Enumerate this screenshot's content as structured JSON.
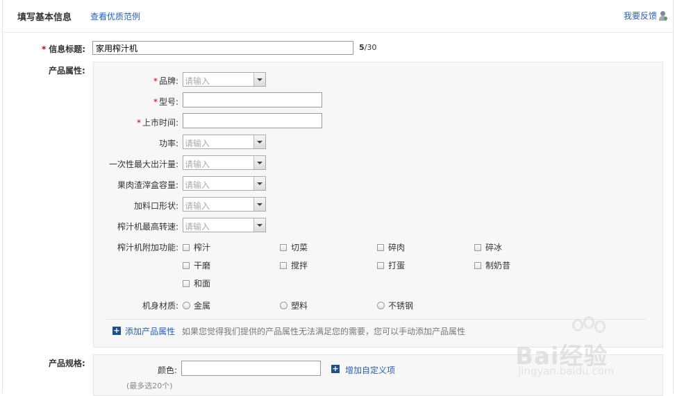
{
  "header": {
    "title": "填写基本信息",
    "example_link": "查看优质范例",
    "feedback": "我要反馈"
  },
  "info_title": {
    "required_mark": "*",
    "label": "信息标题:",
    "value": "家用榨汁机",
    "counter_current": "5",
    "counter_total": "/30"
  },
  "attributes": {
    "label": "产品属性:",
    "fields": [
      {
        "required": "*",
        "label": "品牌:",
        "type": "select",
        "placeholder": "请输入"
      },
      {
        "required": "*",
        "label": "型号:",
        "type": "text",
        "value": ""
      },
      {
        "required": "*",
        "label": "上市时间:",
        "type": "text",
        "value": ""
      },
      {
        "required": "",
        "label": "功率:",
        "type": "select",
        "placeholder": "请输入"
      },
      {
        "required": "",
        "label": "一次性最大出汁量:",
        "type": "select",
        "placeholder": "请输入"
      },
      {
        "required": "",
        "label": "果肉渣滓盒容量:",
        "type": "select",
        "placeholder": "请输入"
      },
      {
        "required": "",
        "label": "加料口形状:",
        "type": "select",
        "placeholder": "请输入"
      },
      {
        "required": "",
        "label": "榨汁机最高转速:",
        "type": "select",
        "placeholder": "请输入"
      }
    ],
    "functions": {
      "label": "榨汁机附加功能:",
      "options": [
        "榨汁",
        "切菜",
        "碎肉",
        "碎冰",
        "干磨",
        "搅拌",
        "打蛋",
        "制奶昔",
        "和面"
      ]
    },
    "material": {
      "label": "机身材质:",
      "options": [
        "金属",
        "塑料",
        "不锈钢"
      ]
    },
    "add_attribute": {
      "icon": "plus-icon",
      "link": "添加产品属性",
      "hint": "如果您觉得我们提供的产品属性无法满足您的需要，您可以手动添加产品属性"
    }
  },
  "specs": {
    "label": "产品规格:",
    "color_label": "颜色:",
    "color_value": "",
    "add_custom": "增加自定义项",
    "max_note": "(最多选20个)"
  },
  "watermark": {
    "logo": "Bai经验",
    "url": "jingyan.baidu.com"
  },
  "colors": {
    "link": "#2a5db0",
    "required": "#cc0000",
    "panel_bg": "#f7f7f7",
    "plus_box": "#1f4f85"
  }
}
